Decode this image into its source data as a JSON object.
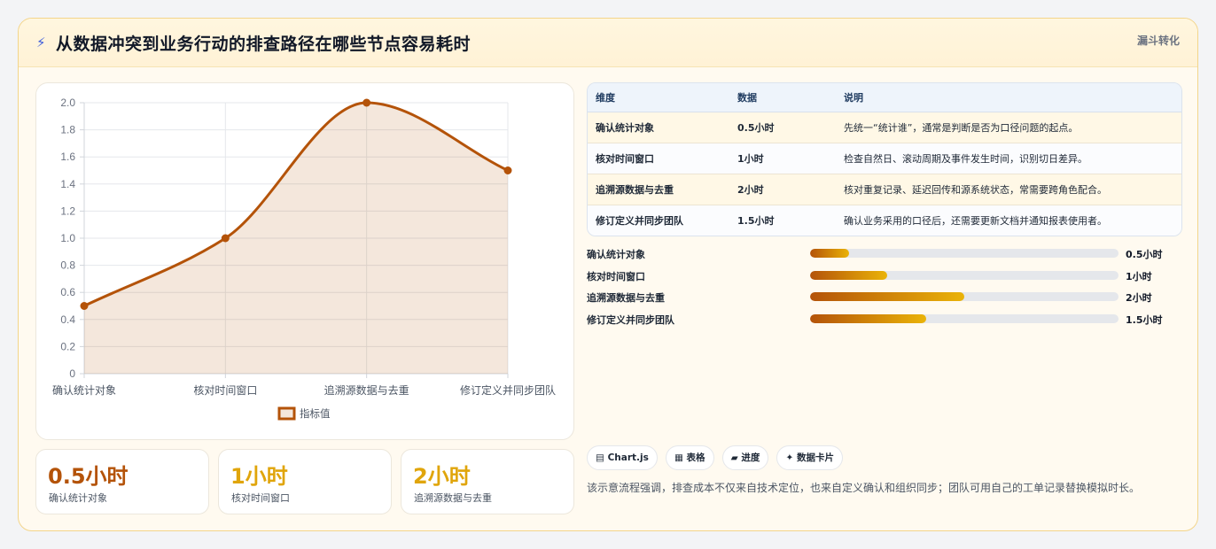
{
  "header": {
    "icon": "lightning-icon",
    "title": "从数据冲突到业务行动的排查路径在哪些节点容易耗时",
    "tag": "漏斗转化"
  },
  "chart_data": {
    "type": "line",
    "categories": [
      "确认统计对象",
      "核对时间窗口",
      "追溯源数据与去重",
      "修订定义并同步团队"
    ],
    "series": [
      {
        "name": "指标值",
        "values": [
          0.5,
          1,
          2,
          1.5
        ],
        "color": "#b45309"
      }
    ],
    "yticks": [
      "0",
      "0.2",
      "0.4",
      "0.6",
      "0.8",
      "1.0",
      "1.2",
      "1.4",
      "1.6",
      "1.8",
      "2.0"
    ],
    "ylim": [
      0,
      2
    ],
    "grid": true,
    "legend": "bottom",
    "area_fill": true
  },
  "kpis": [
    {
      "value": "0.5小时",
      "label": "确认统计对象",
      "color": "#b45309"
    },
    {
      "value": "1小时",
      "label": "核对时间窗口",
      "color": "#e0a50b"
    },
    {
      "value": "2小时",
      "label": "追溯源数据与去重",
      "color": "#e0a50b"
    }
  ],
  "table": {
    "headers": [
      "维度",
      "数据",
      "说明"
    ],
    "rows": [
      [
        "确认统计对象",
        "0.5小时",
        "先统一“统计谁”，通常是判断是否为口径问题的起点。"
      ],
      [
        "核对时间窗口",
        "1小时",
        "检查自然日、滚动周期及事件发生时间，识别切日差异。"
      ],
      [
        "追溯源数据与去重",
        "2小时",
        "核对重复记录、延迟回传和源系统状态，常需要跨角色配合。"
      ],
      [
        "修订定义并同步团队",
        "1.5小时",
        "确认业务采用的口径后，还需要更新文档并通知报表使用者。"
      ]
    ]
  },
  "progress": [
    {
      "label": "确认统计对象",
      "value": "0.5小时",
      "fraction": 0.125
    },
    {
      "label": "核对时间窗口",
      "value": "1小时",
      "fraction": 0.25
    },
    {
      "label": "追溯源数据与去重",
      "value": "2小时",
      "fraction": 0.5
    },
    {
      "label": "修订定义并同步团队",
      "value": "1.5小时",
      "fraction": 0.375
    }
  ],
  "chips": [
    "▤ Chart.js",
    "▦ 表格",
    "▰ 进度",
    "✦ 数据卡片"
  ],
  "note": "该示意流程强调，排查成本不仅来自技术定位，也来自定义确认和组织同步；团队可用自己的工单记录替换模拟时长。",
  "colors": {
    "accent": "#b45309",
    "accent_light": "#eab308",
    "card_bg": "#fffaf0",
    "border": "#f3d58a"
  }
}
